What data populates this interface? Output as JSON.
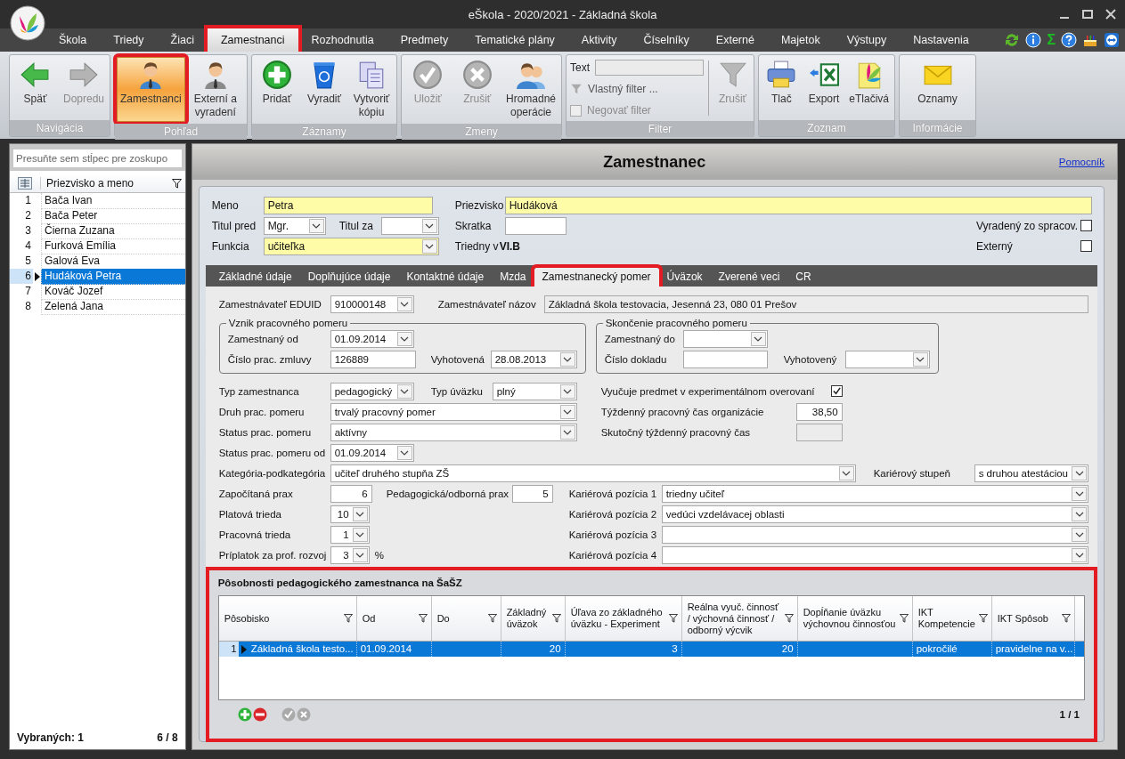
{
  "window": {
    "title": "eŠkola - 2020/2021 - Základná škola"
  },
  "menu": [
    {
      "label": "Škola",
      "selected": false,
      "highlighted": false
    },
    {
      "label": "Triedy",
      "selected": false,
      "highlighted": false
    },
    {
      "label": "Žiaci",
      "selected": false,
      "highlighted": false
    },
    {
      "label": "Zamestnanci",
      "selected": true,
      "highlighted": true
    },
    {
      "label": "Rozhodnutia",
      "selected": false,
      "highlighted": false
    },
    {
      "label": "Predmety",
      "selected": false,
      "highlighted": false
    },
    {
      "label": "Tematické plány",
      "selected": false,
      "highlighted": false
    },
    {
      "label": "Aktivity",
      "selected": false,
      "highlighted": false
    },
    {
      "label": "Číselníky",
      "selected": false,
      "highlighted": false
    },
    {
      "label": "Externé",
      "selected": false,
      "highlighted": false
    },
    {
      "label": "Majetok",
      "selected": false,
      "highlighted": false
    },
    {
      "label": "Výstupy",
      "selected": false,
      "highlighted": false
    },
    {
      "label": "Nastavenia",
      "selected": false,
      "highlighted": false
    }
  ],
  "quick_tools": {
    "sum": "Σ"
  },
  "ribbon": [
    {
      "label": "Navigácia",
      "kind": "buttons",
      "buttons": [
        {
          "label": "Späť",
          "disabled": false,
          "selected": false,
          "highlighted": false
        },
        {
          "label": "Dopredu",
          "disabled": true,
          "selected": false,
          "highlighted": false
        }
      ]
    },
    {
      "label": "Pohľad",
      "kind": "buttons",
      "buttons": [
        {
          "label": "Zamestnanci",
          "disabled": false,
          "selected": true,
          "highlighted": true
        },
        {
          "label": "Externí a vyradení",
          "disabled": false,
          "selected": false,
          "highlighted": false
        }
      ]
    },
    {
      "label": "Záznamy",
      "kind": "buttons",
      "buttons": [
        {
          "label": "Pridať",
          "disabled": false,
          "selected": false,
          "highlighted": false
        },
        {
          "label": "Vyradiť",
          "disabled": false,
          "selected": false,
          "highlighted": false
        },
        {
          "label": "Vytvoriť kópiu",
          "disabled": false,
          "selected": false,
          "highlighted": false
        }
      ]
    },
    {
      "label": "Zmeny",
      "kind": "buttons",
      "buttons": [
        {
          "label": "Uložiť",
          "disabled": true,
          "selected": false,
          "highlighted": false
        },
        {
          "label": "Zrušiť",
          "disabled": true,
          "selected": false,
          "highlighted": false
        },
        {
          "label": "Hromadné operácie",
          "disabled": false,
          "selected": false,
          "highlighted": false
        }
      ]
    },
    {
      "label": "Filter",
      "kind": "filter",
      "text_label": "Text",
      "custom_filter": "Vlastný filter ...",
      "negate": {
        "label": "Negovať filter",
        "checked": false,
        "disabled": true
      },
      "buttons": [
        {
          "label": "Zrušiť",
          "disabled": true,
          "selected": false,
          "highlighted": false
        }
      ]
    },
    {
      "label": "Zoznam",
      "kind": "buttons",
      "buttons": [
        {
          "label": "Tlač",
          "disabled": false,
          "selected": false,
          "highlighted": false
        },
        {
          "label": "Export",
          "disabled": false,
          "selected": false,
          "highlighted": false
        },
        {
          "label": "eTlačivá",
          "disabled": false,
          "selected": false,
          "highlighted": false
        }
      ]
    },
    {
      "label": "Informácie",
      "kind": "buttons",
      "buttons": [
        {
          "label": "Oznamy",
          "disabled": false,
          "selected": false,
          "highlighted": false
        }
      ]
    }
  ],
  "employee_list": {
    "group_hint": "Presuňte sem stĺpec pre zoskupo",
    "column": "Priezvisko a meno",
    "rows": [
      {
        "number": "1",
        "name": "Bača Ivan",
        "selected": false
      },
      {
        "number": "2",
        "name": "Bača Peter",
        "selected": false
      },
      {
        "number": "3",
        "name": "Čierna Zuzana",
        "selected": false
      },
      {
        "number": "4",
        "name": "Furková Emília",
        "selected": false
      },
      {
        "number": "5",
        "name": "Galová Eva",
        "selected": false
      },
      {
        "number": "6",
        "name": "Hudáková Petra",
        "selected": true
      },
      {
        "number": "7",
        "name": "Kováč Jozef",
        "selected": false
      },
      {
        "number": "8",
        "name": "Zelená Jana",
        "selected": false
      }
    ],
    "selected_count": "Vybraných: 1",
    "position": "6 / 8"
  },
  "detail": {
    "title": "Zamestnanec",
    "help_link": "Pomocník"
  },
  "person": {
    "meno": {
      "label": "Meno",
      "value": "Petra",
      "required": true
    },
    "priezvisko": {
      "label": "Priezvisko",
      "value": "Hudáková",
      "required": true
    },
    "titul_pred": {
      "label": "Titul pred",
      "value": "Mgr.",
      "required": false
    },
    "titul_za": {
      "label": "Titul za",
      "required": false
    },
    "skratka": {
      "label": "Skratka",
      "required": false
    },
    "funkcia": {
      "label": "Funkcia",
      "value": "učiteľka",
      "required": true
    },
    "triedny_v": {
      "label": "Triedny v",
      "value": "VI.B"
    },
    "vyradeny": {
      "label": "Vyradený zo spracov.",
      "checked": false
    },
    "externy": {
      "label": "Externý",
      "checked": false
    }
  },
  "tabs": [
    {
      "label": "Základné údaje",
      "selected": false,
      "highlighted": false
    },
    {
      "label": "Doplňujúce údaje",
      "selected": false,
      "highlighted": false
    },
    {
      "label": "Kontaktné údaje",
      "selected": false,
      "highlighted": false
    },
    {
      "label": "Mzda",
      "selected": false,
      "highlighted": false
    },
    {
      "label": "Zamestnanecký pomer",
      "selected": true,
      "highlighted": true
    },
    {
      "label": "Úväzok",
      "selected": false,
      "highlighted": false
    },
    {
      "label": "Zverené veci",
      "selected": false,
      "highlighted": false
    },
    {
      "label": "CR",
      "selected": false,
      "highlighted": false
    }
  ],
  "employment": {
    "eduid": {
      "label": "Zamestnávateľ EDUID",
      "value": "910000148"
    },
    "nazov": {
      "label": "Zamestnávateľ názov",
      "value": "Základná škola testovacia, Jesenná 23, 080 01 Prešov",
      "readonly": true
    },
    "vznik": {
      "title": "Vznik pracovného pomeru",
      "od": {
        "label": "Zamestnaný od",
        "value": "01.09.2014"
      },
      "cislo": {
        "label": "Číslo prac. zmluvy",
        "value": "126889"
      },
      "vyhotovena": {
        "label": "Vyhotovená",
        "value": "28.08.2013"
      }
    },
    "skoncenie": {
      "title": "Skončenie pracovného pomeru",
      "do": {
        "label": "Zamestnaný do"
      },
      "cislo": {
        "label": "Číslo dokladu"
      },
      "vyhotoveny": {
        "label": "Vyhotovený"
      }
    },
    "typ_zamestnanca": {
      "label": "Typ zamestnanca",
      "value": "pedagogický"
    },
    "typ_uvazku": {
      "label": "Typ úväzku",
      "value": "plný"
    },
    "experimental": {
      "label": "Vyučuje predmet v experimentálnom overovaní",
      "checked": true
    },
    "druh": {
      "label": "Druh prac. pomeru",
      "value": "trvalý pracovný pomer"
    },
    "tyzdenny": {
      "label": "Týždenný pracovný čas organizácie",
      "value": "38,50",
      "readonly": false
    },
    "status": {
      "label": "Status prac. pomeru",
      "value": "aktívny"
    },
    "skutocny": {
      "label": "Skutočný týždenný pracovný čas",
      "readonly": true
    },
    "status_od": {
      "label": "Status prac. pomeru od",
      "value": "01.09.2014"
    },
    "kategoria": {
      "label": "Kategória-podkategória",
      "value": "učiteľ druhého stupňa ZŠ"
    },
    "karierovy_stupen": {
      "label": "Kariérový stupeň",
      "value": "s druhou atestáciou"
    },
    "zapocitana_prax": {
      "label": "Započítaná prax",
      "value": "6"
    },
    "ped_prax": {
      "label": "Pedagogická/odborná prax",
      "value": "5"
    },
    "platova_trieda": {
      "label": "Platová trieda",
      "value": "10"
    },
    "pracovna_trieda": {
      "label": "Pracovná trieda",
      "value": "1"
    },
    "priplatok": {
      "label": "Príplatok za prof. rozvoj",
      "value": "3",
      "unit": "%"
    },
    "pozicie": [
      {
        "label": "Kariérová pozícia 1",
        "value": "triedny učiteľ"
      },
      {
        "label": "Kariérová pozícia 2",
        "value": "vedúci vzdelávacej oblasti"
      },
      {
        "label": "Kariérová pozícia 3"
      },
      {
        "label": "Kariérová pozícia 4"
      }
    ]
  },
  "assignments": {
    "title": "Pôsobnosti pedagogického zamestnanca na ŠaŠZ",
    "highlighted": true,
    "columns": [
      {
        "label": "Pôsobisko"
      },
      {
        "label": "Od"
      },
      {
        "label": "Do"
      },
      {
        "label": "Základný úväzok"
      },
      {
        "label": "Úľava zo základného úväzku - Experiment"
      },
      {
        "label": "Reálna vyuč. činnosť / výchovná činnosť / odborný výcvik"
      },
      {
        "label": "Dopĺňanie úväzku výchovnou činnosťou"
      },
      {
        "label": "IKT Kompetencie"
      },
      {
        "label": "IKT Spôsob"
      }
    ],
    "rows": [
      {
        "number": "1",
        "selected": true,
        "cells": [
          "Základná škola testo...",
          "01.09.2014",
          null,
          "20",
          "3",
          "20",
          null,
          "pokročilé",
          "pravidelne na v..."
        ]
      }
    ],
    "pager": "1 / 1"
  }
}
